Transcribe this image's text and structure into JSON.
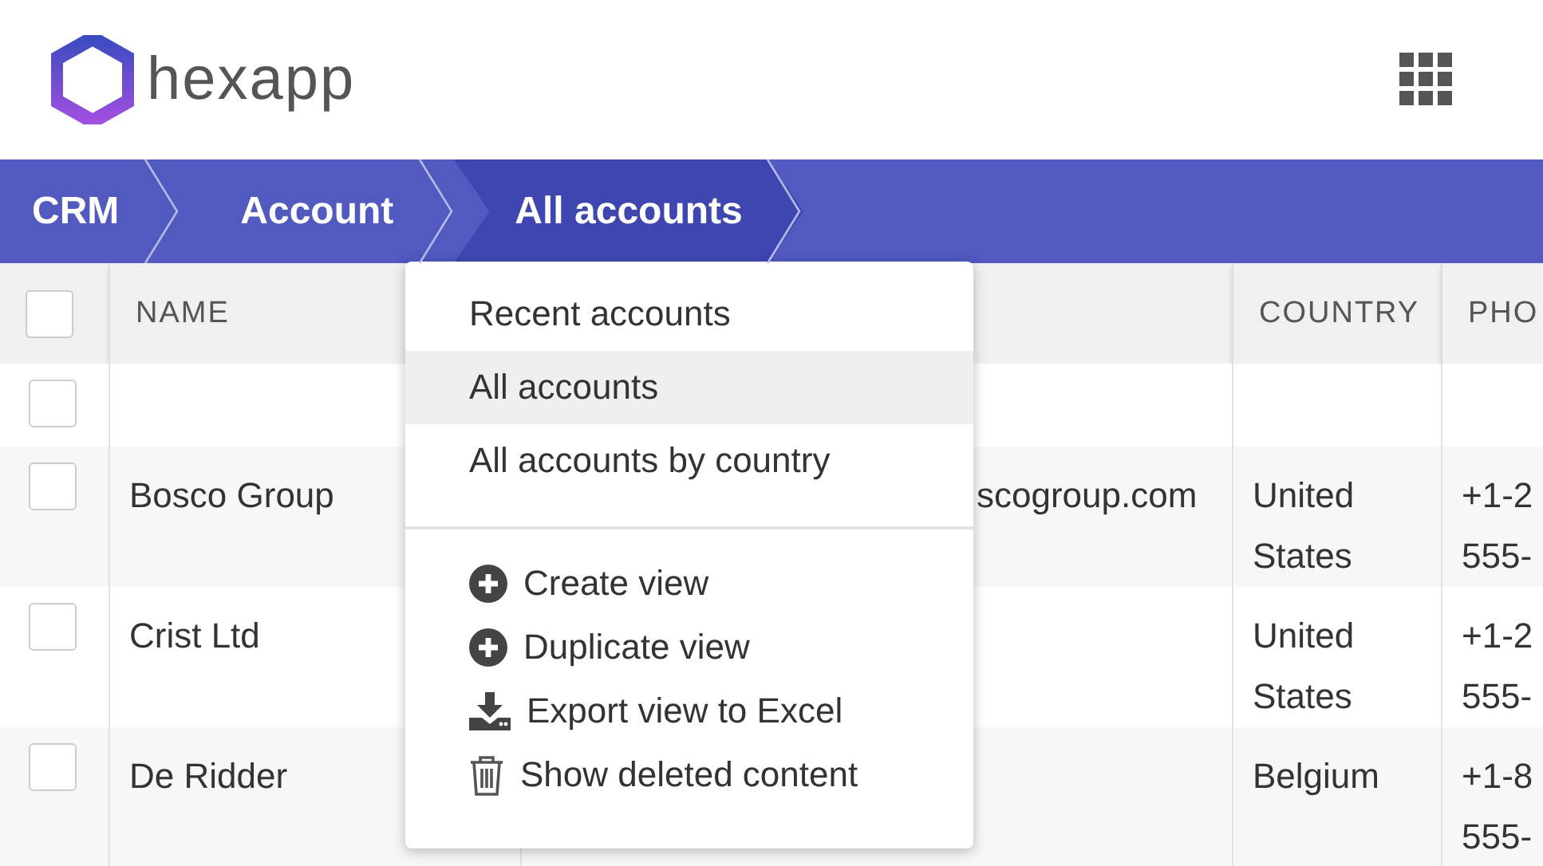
{
  "header": {
    "logo_text": "hexapp"
  },
  "breadcrumbs": [
    {
      "label": "CRM",
      "selected": false
    },
    {
      "label": "Account",
      "selected": false
    },
    {
      "label": "All accounts",
      "selected": true
    }
  ],
  "table": {
    "select_all_checked": false,
    "columns": [
      "NAME",
      "COUNTRY",
      "PHO"
    ],
    "rows": [
      {
        "checked": false,
        "name": "",
        "email": "",
        "country": "",
        "phone": ""
      },
      {
        "checked": false,
        "name": "Bosco Group",
        "email": "scogroup.com",
        "country": "United States",
        "phone": "+1-2\n555-"
      },
      {
        "checked": false,
        "name": "Crist Ltd",
        "email": "",
        "country": "United States",
        "phone": "+1-2\n555-"
      },
      {
        "checked": false,
        "name": "De Ridder",
        "email": "",
        "country": "Belgium",
        "phone": "+1-8\n555-"
      }
    ]
  },
  "view_menu": {
    "views": [
      {
        "label": "Recent accounts",
        "selected": false
      },
      {
        "label": "All accounts",
        "selected": true
      },
      {
        "label": "All accounts by country",
        "selected": false
      }
    ],
    "actions": [
      {
        "kind": "create",
        "label": "Create view"
      },
      {
        "kind": "duplicate",
        "label": "Duplicate view"
      },
      {
        "kind": "export",
        "label": "Export view to Excel"
      },
      {
        "kind": "deleted",
        "label": "Show deleted content"
      }
    ]
  }
}
